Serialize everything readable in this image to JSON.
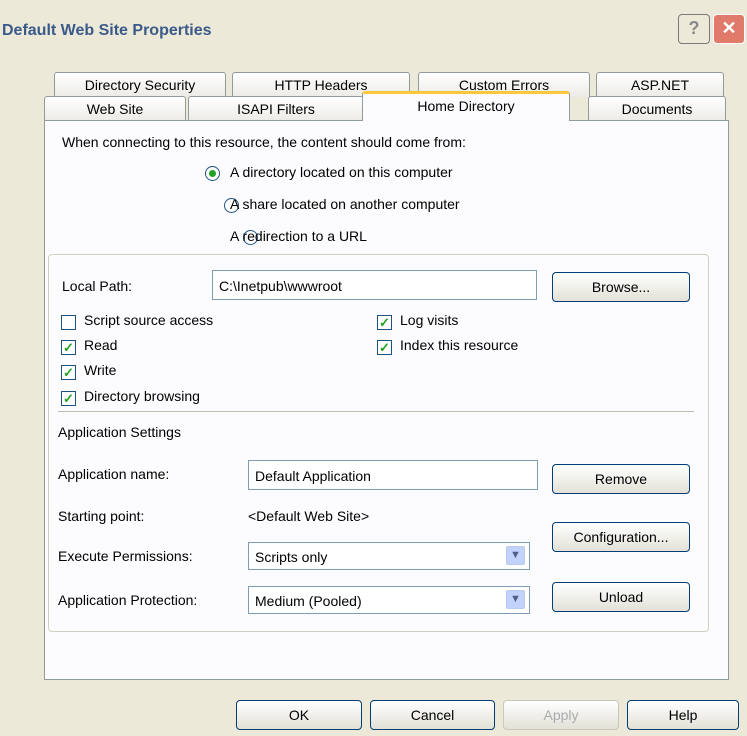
{
  "window": {
    "title": "Default Web Site Properties",
    "help_glyph": "?",
    "close_glyph": "✕"
  },
  "tabs_row1": [
    "Directory Security",
    "HTTP Headers",
    "Custom Errors",
    "ASP.NET"
  ],
  "tabs_row2": [
    "Web Site",
    "ISAPI Filters",
    "Home Directory",
    "Documents"
  ],
  "active_tab": "Home Directory",
  "content_source": {
    "prompt": "When connecting to this resource, the content should come from:",
    "options": [
      "A directory located on this computer",
      "A share located on another computer",
      "A redirection to a URL"
    ],
    "selected": "A directory located on this computer"
  },
  "local_path": {
    "label": "Local Path:",
    "value": "C:\\Inetpub\\wwwroot",
    "browse": "Browse..."
  },
  "checkboxes": {
    "script_source": {
      "label": "Script source access",
      "checked": false
    },
    "read": {
      "label": "Read",
      "checked": true
    },
    "write": {
      "label": "Write",
      "checked": true
    },
    "dir_browsing": {
      "label": "Directory browsing",
      "checked": true
    },
    "log_visits": {
      "label": "Log visits",
      "checked": true
    },
    "index_resource": {
      "label": "Index this resource",
      "checked": true
    }
  },
  "app_settings": {
    "header": "Application Settings",
    "name_label": "Application name:",
    "name_value": "Default Application",
    "remove": "Remove",
    "start_label": "Starting point:",
    "start_value": "<Default Web Site>",
    "configuration": "Configuration...",
    "exec_label": "Execute Permissions:",
    "exec_value": "Scripts only",
    "protect_label": "Application Protection:",
    "protect_value": "Medium (Pooled)",
    "unload": "Unload"
  },
  "buttons": {
    "ok": "OK",
    "cancel": "Cancel",
    "apply": "Apply",
    "help": "Help"
  },
  "colors": {
    "dialog_bg": "#ECE9D8",
    "panel_bg": "#FCFCFE",
    "check": "#21A121",
    "tab_highlight": "#FFC83C"
  }
}
